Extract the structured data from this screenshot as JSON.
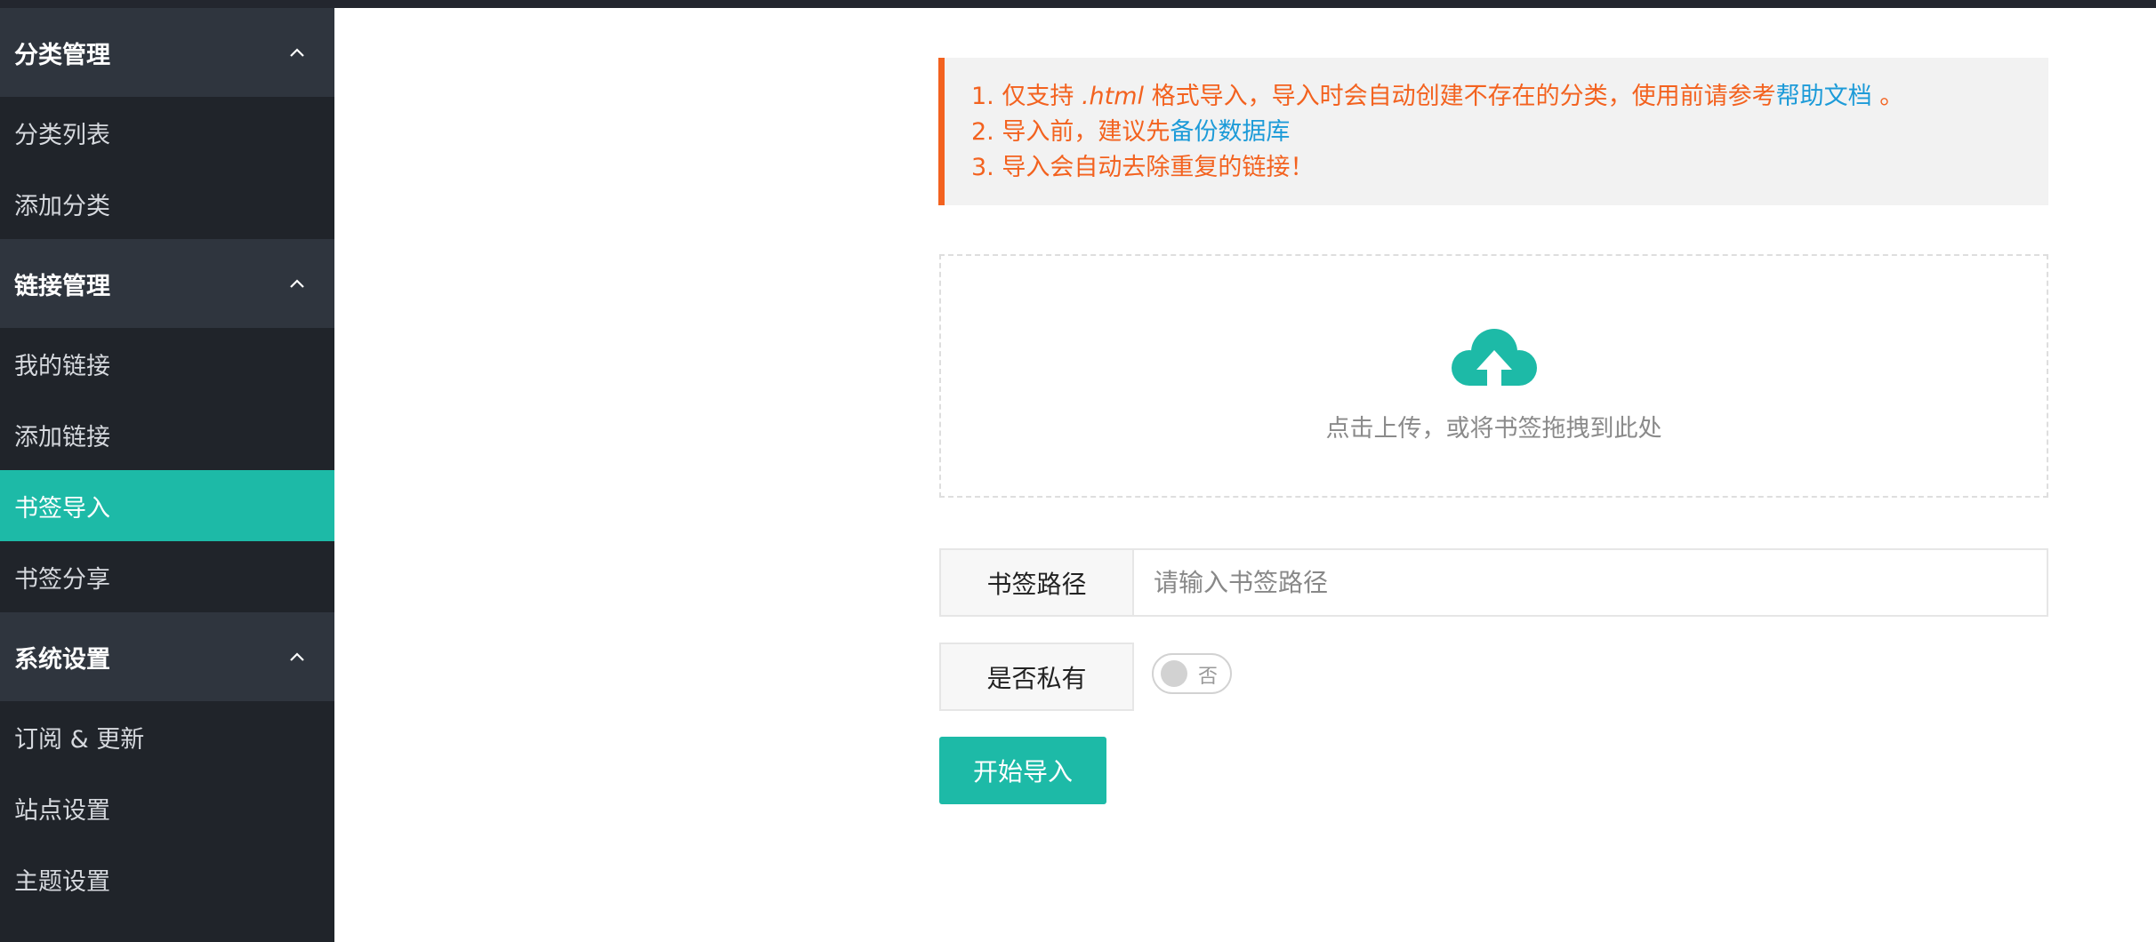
{
  "sidebar": {
    "groups": [
      {
        "title": "分类管理",
        "items": [
          "分类列表",
          "添加分类"
        ]
      },
      {
        "title": "链接管理",
        "items": [
          "我的链接",
          "添加链接",
          "书签导入",
          "书签分享"
        ]
      },
      {
        "title": "系统设置",
        "items": [
          "订阅 & 更新",
          "站点设置",
          "主题设置"
        ]
      }
    ],
    "active_item": "书签导入"
  },
  "notice": {
    "line1_prefix": "1. 仅支持 ",
    "line1_format": ".html",
    "line1_mid": " 格式导入，导入时会自动创建不存在的分类，使用前请参考",
    "line1_link": "帮助文档",
    "line1_suffix": " 。",
    "line2_prefix": "2. 导入前，建议先",
    "line2_link": "备份数据库",
    "line3": "3. 导入会自动去除重复的链接！"
  },
  "upload": {
    "text": "点击上传，或将书签拖拽到此处",
    "icon": "cloud-upload-icon"
  },
  "form": {
    "path_label": "书签路径",
    "path_placeholder": "请输入书签路径",
    "path_value": "",
    "private_label": "是否私有",
    "private_switch_text": "否",
    "private_on": false
  },
  "submit_label": "开始导入",
  "colors": {
    "accent": "#1dbaa7",
    "warning": "#f3621f",
    "link": "#1d9bd8",
    "sidebar_bg": "#20242a",
    "sidebar_header_bg": "#2f353e"
  }
}
